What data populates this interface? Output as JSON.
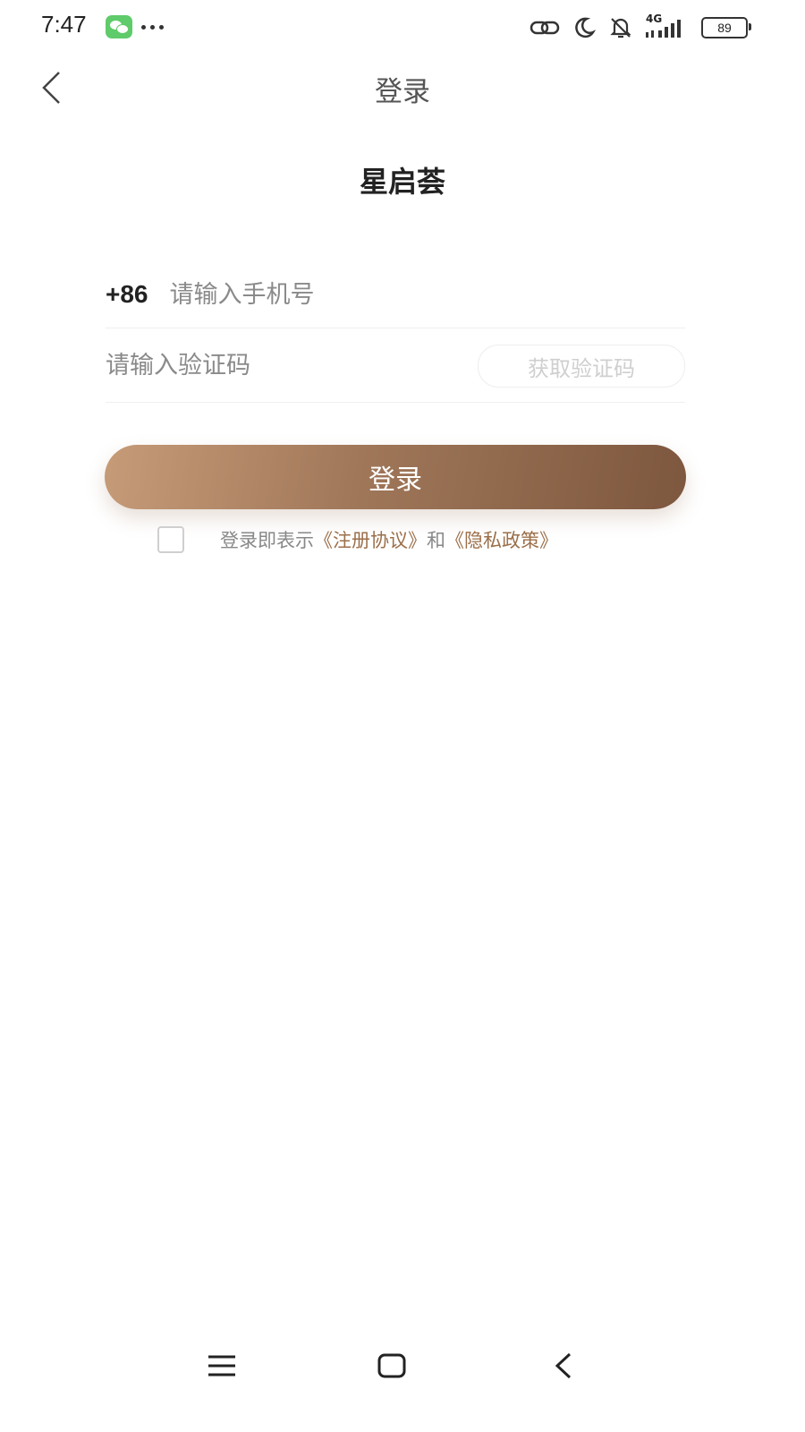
{
  "status_bar": {
    "time": "7:47",
    "network": "4G",
    "battery": "89"
  },
  "nav": {
    "title": "登录"
  },
  "brand": {
    "title": "星启荟"
  },
  "form": {
    "country_code": "+86",
    "phone_placeholder": "请输入手机号",
    "code_placeholder": "请输入验证码",
    "get_code_label": "获取验证码"
  },
  "login_button": {
    "label": "登录"
  },
  "agreement": {
    "prefix": "登录即表示",
    "terms_link": "《注册协议》",
    "conjunction": "和",
    "privacy_link": "《隐私政策》",
    "checked": false
  },
  "colors": {
    "accent": "#9b6f4a",
    "button_start": "#c69b78",
    "button_end": "#7d573e"
  }
}
